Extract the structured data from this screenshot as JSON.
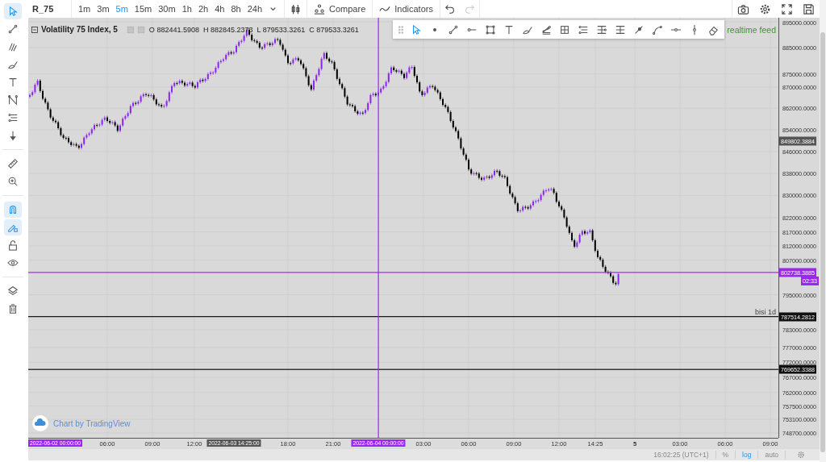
{
  "symbol": "R_75",
  "intervals": [
    {
      "label": "1m",
      "selected": false
    },
    {
      "label": "3m",
      "selected": false
    },
    {
      "label": "5m",
      "selected": true
    },
    {
      "label": "15m",
      "selected": false
    },
    {
      "label": "30m",
      "selected": false
    },
    {
      "label": "1h",
      "selected": false
    },
    {
      "label": "2h",
      "selected": false
    },
    {
      "label": "4h",
      "selected": false
    },
    {
      "label": "8h",
      "selected": false
    },
    {
      "label": "24h",
      "selected": false
    }
  ],
  "toolbar_buttons": [
    {
      "kind": "compare",
      "label": "Compare"
    },
    {
      "kind": "indicators",
      "label": "Indicators"
    }
  ],
  "history": [
    {
      "kind": "undo",
      "disabled": false
    },
    {
      "kind": "redo",
      "disabled": true
    }
  ],
  "left_tools": [
    {
      "on": true
    },
    {
      "on": false
    },
    {
      "on": false
    },
    {
      "on": false
    },
    {
      "on": false
    },
    {
      "on": false
    },
    {
      "on": false
    },
    {
      "on": false
    },
    {
      "on": false
    },
    {
      "on": false
    },
    {
      "on": true
    },
    {
      "on": true
    },
    {
      "on": false
    },
    {
      "on": false
    },
    {
      "on": false
    },
    {
      "on": false
    }
  ],
  "legend": {
    "title": "Volatility 75 Index, 5",
    "ohlc": [
      {
        "label": "O",
        "value": "882441.5908"
      },
      {
        "label": "H",
        "value": "882845.2373"
      },
      {
        "label": "L",
        "value": "879533.3261"
      },
      {
        "label": "C",
        "value": "879533.3261"
      }
    ]
  },
  "drawing_tools": [
    {
      "selected": true
    },
    {
      "selected": false
    },
    {
      "selected": false
    },
    {
      "selected": false
    },
    {
      "selected": false
    },
    {
      "selected": false
    },
    {
      "selected": false
    },
    {
      "selected": false
    },
    {
      "selected": false
    },
    {
      "selected": false
    },
    {
      "selected": false
    },
    {
      "selected": false
    },
    {
      "selected": false
    },
    {
      "selected": false
    },
    {
      "selected": false
    },
    {
      "selected": false
    },
    {
      "selected": false
    }
  ],
  "realtime_label": "realtime feed",
  "attribution": "Chart by TradingView",
  "price_axis": {
    "ticks": [
      "895000.0000",
      "885000.0000",
      "875000.0000",
      "870000.0000",
      "862000.0000",
      "854000.0000",
      "846000.0000",
      "838000.0000",
      "830000.0000",
      "822000.0000",
      "817000.0000",
      "812000.0000",
      "807000.0000",
      "795000.0000",
      "783000.0000",
      "777000.0000",
      "772000.0000",
      "767000.0000",
      "762000.0000",
      "757500.0000",
      "753100.0000",
      "748700.0000"
    ],
    "badges": [
      {
        "value": "849802.3884",
        "color": "#555555",
        "line": false
      },
      {
        "value": "802738.3885",
        "color": "#9c27f0",
        "line": true,
        "countdown": "02:33"
      },
      {
        "value": "787514.2812",
        "color": "#111111",
        "line": true,
        "label": "bisi 1d"
      },
      {
        "value": "769652.3388",
        "color": "#111111",
        "line": true
      }
    ]
  },
  "time_axis": {
    "ticks": [
      {
        "label": "06:00",
        "kind": "time"
      },
      {
        "label": "09:00",
        "kind": "time"
      },
      {
        "label": "12:00",
        "kind": "time"
      },
      {
        "label": "18:00",
        "kind": "time"
      },
      {
        "label": "21:00",
        "kind": "time"
      },
      {
        "label": "03:00",
        "kind": "time"
      },
      {
        "label": "06:00",
        "kind": "time"
      },
      {
        "label": "09:00",
        "kind": "time"
      },
      {
        "label": "12:00",
        "kind": "time"
      },
      {
        "label": "14:25",
        "kind": "time"
      },
      {
        "label": "5",
        "kind": "day"
      },
      {
        "label": "03:00",
        "kind": "time"
      },
      {
        "label": "06:00",
        "kind": "time"
      },
      {
        "label": "09:00",
        "kind": "time"
      }
    ],
    "badges": [
      {
        "text": "2022-06-02 00:00:00",
        "color": "#9c27f0",
        "line": false
      },
      {
        "text": "2022-06-03 14:25:00",
        "color": "#555555",
        "line": false
      },
      {
        "text": "2022-06-04 00:00:00",
        "color": "#9c27f0",
        "line": true
      }
    ]
  },
  "status_bar": {
    "time": "16:02:25 (UTC+1)",
    "scale_options": [
      {
        "label": "%",
        "selected": false
      },
      {
        "label": "log",
        "selected": true
      },
      {
        "label": "auto",
        "selected": false
      }
    ]
  }
}
